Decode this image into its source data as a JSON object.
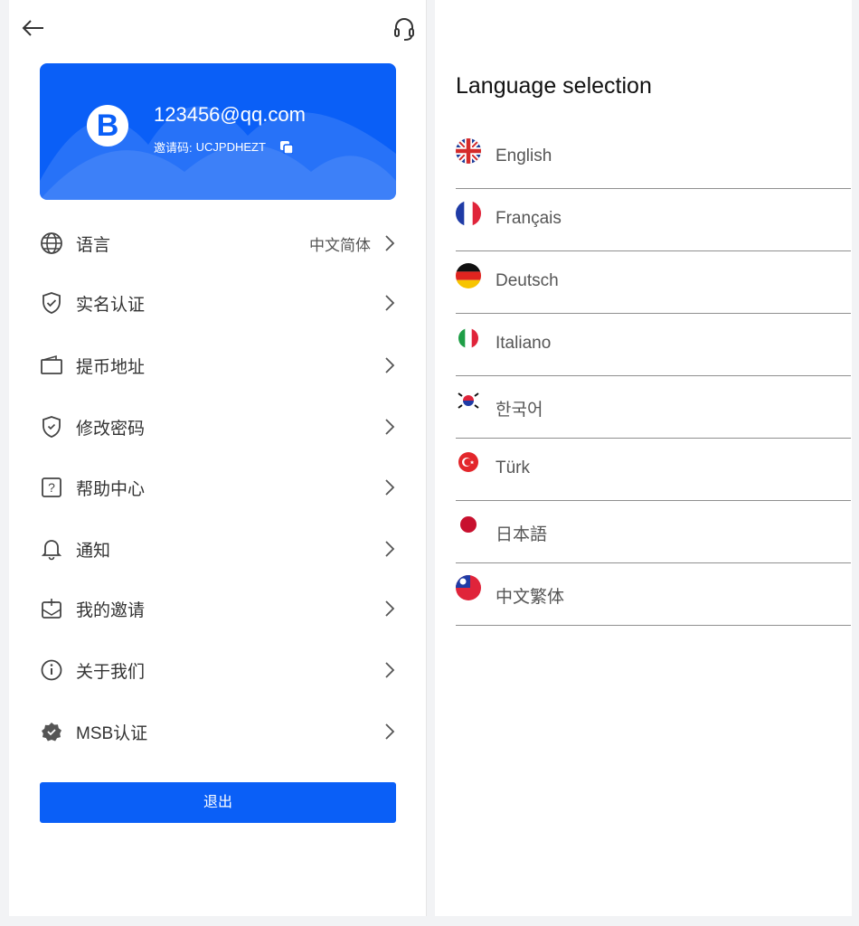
{
  "left": {
    "profile": {
      "email": "123456@qq.com",
      "invite_label": "邀请码:",
      "invite_code": "UCJPDHEZT",
      "logo_letter": "B"
    },
    "menu": [
      {
        "label": "语言",
        "value": "中文简体",
        "icon": "globe-icon"
      },
      {
        "label": "实名认证",
        "icon": "shield-check-icon"
      },
      {
        "label": "提币地址",
        "icon": "wallet-icon"
      },
      {
        "label": "修改密码",
        "icon": "shield-lock-icon"
      },
      {
        "label": "帮助中心",
        "icon": "help-icon"
      },
      {
        "label": "通知",
        "icon": "bell-icon"
      },
      {
        "label": "我的邀请",
        "icon": "invite-icon"
      },
      {
        "label": "关于我们",
        "icon": "info-icon"
      },
      {
        "label": "MSB认证",
        "icon": "verified-badge-icon"
      }
    ],
    "logout_label": "退出"
  },
  "right": {
    "title": "Language selection",
    "languages": [
      {
        "name": "English",
        "flag": "uk-flag-icon"
      },
      {
        "name": "Français",
        "flag": "france-flag-icon"
      },
      {
        "name": "Deutsch",
        "flag": "germany-flag-icon"
      },
      {
        "name": "Italiano",
        "flag": "italy-flag-icon"
      },
      {
        "name": "한국어",
        "flag": "korea-flag-icon"
      },
      {
        "name": "Türk",
        "flag": "turkey-flag-icon"
      },
      {
        "name": "日本語",
        "flag": "japan-flag-icon"
      },
      {
        "name": "中文繁体",
        "flag": "taiwan-flag-icon"
      }
    ]
  },
  "colors": {
    "accent": "#0a5ff7",
    "divider": "#8f8f8f",
    "text_primary": "#333333",
    "text_secondary": "#555555"
  }
}
